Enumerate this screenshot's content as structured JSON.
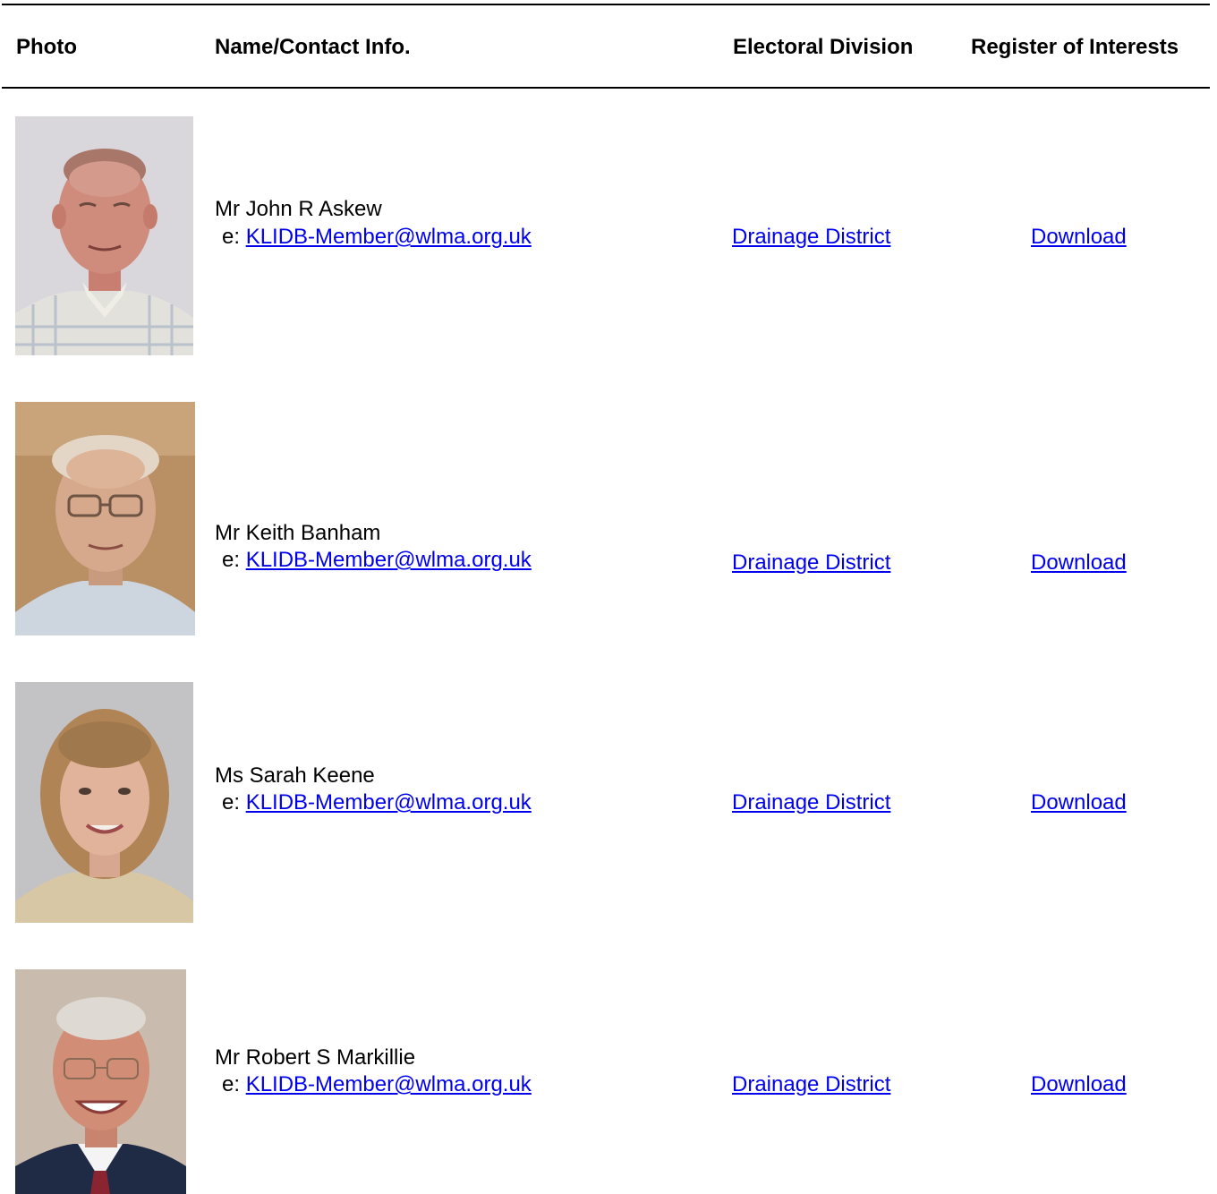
{
  "table": {
    "headers": {
      "photo": "Photo",
      "name": "Name/Contact Info.",
      "division": "Electoral Division",
      "register": "Register of Interests"
    },
    "members": [
      {
        "name": "Mr John R Askew",
        "email_prefix": "e:",
        "email": "KLIDB-Member@wlma.org.uk",
        "division": "Drainage District",
        "register": "Download"
      },
      {
        "name": "Mr Keith Banham",
        "email_prefix": "e:",
        "email": "KLIDB-Member@wlma.org.uk",
        "division": "Drainage District",
        "register": "Download"
      },
      {
        "name": "Ms Sarah Keene",
        "email_prefix": "e:",
        "email": "KLIDB-Member@wlma.org.uk",
        "division": "Drainage District",
        "register": "Download"
      },
      {
        "name": "Mr Robert S Markillie",
        "email_prefix": "e:",
        "email": "KLIDB-Member@wlma.org.uk",
        "division": "Drainage District",
        "register": "Download"
      }
    ]
  },
  "colors": {
    "link": "#0000ee",
    "text": "#000000",
    "rule": "#000000"
  }
}
